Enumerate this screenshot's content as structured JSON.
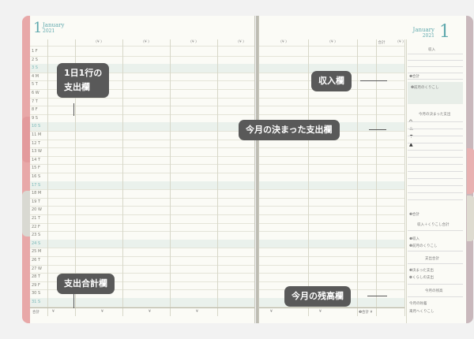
{
  "left_page": {
    "month_number": "1",
    "month_name": "January",
    "year": "2021",
    "column_headers": [
      "(¥      )",
      "(¥      )",
      "(¥      )",
      "(¥      )"
    ],
    "rows": [
      {
        "day": "1",
        "wd": "F"
      },
      {
        "day": "2",
        "wd": "S"
      },
      {
        "day": "3",
        "wd": "S"
      },
      {
        "day": "4",
        "wd": "M"
      },
      {
        "day": "5",
        "wd": "T"
      },
      {
        "day": "6",
        "wd": "W"
      },
      {
        "day": "7",
        "wd": "T"
      },
      {
        "day": "8",
        "wd": "F"
      },
      {
        "day": "9",
        "wd": "S"
      },
      {
        "day": "10",
        "wd": "S"
      },
      {
        "day": "11",
        "wd": "M"
      },
      {
        "day": "12",
        "wd": "T"
      },
      {
        "day": "13",
        "wd": "W"
      },
      {
        "day": "14",
        "wd": "T"
      },
      {
        "day": "15",
        "wd": "F"
      },
      {
        "day": "16",
        "wd": "S"
      },
      {
        "day": "17",
        "wd": "S"
      },
      {
        "day": "18",
        "wd": "M"
      },
      {
        "day": "19",
        "wd": "T"
      },
      {
        "day": "20",
        "wd": "W"
      },
      {
        "day": "21",
        "wd": "T"
      },
      {
        "day": "22",
        "wd": "F"
      },
      {
        "day": "23",
        "wd": "S"
      },
      {
        "day": "24",
        "wd": "S"
      },
      {
        "day": "25",
        "wd": "M"
      },
      {
        "day": "26",
        "wd": "T"
      },
      {
        "day": "27",
        "wd": "W"
      },
      {
        "day": "28",
        "wd": "T"
      },
      {
        "day": "29",
        "wd": "F"
      },
      {
        "day": "30",
        "wd": "S"
      },
      {
        "day": "31",
        "wd": "S"
      }
    ],
    "total_label": "合計",
    "yen": "¥"
  },
  "right_page": {
    "month_number": "1",
    "month_name": "January",
    "year": "2021",
    "column_headers": [
      "(¥      )",
      "(¥      )",
      "合計",
      "(¥      )"
    ],
    "total_label": "合計",
    "yen": "¥",
    "total_yen": "❸合計 ¥",
    "side": {
      "income_title": "収入",
      "income_total": "❶合計",
      "savings_label": "❷前月のくりこし",
      "fixed_title": "今月の決まった支出",
      "carry_total": "❸合計",
      "carry_title": "収入＋くりこし合計",
      "income_item": "❶収入",
      "savings_item": "❷前月のくりこし",
      "expense_title": "支出合計",
      "fixed_item": "❸決まった支出",
      "variable_item": "❹くらしの支出",
      "balance_title": "今月の残高",
      "this_month_savings": "今月の貯蓄",
      "next_month_carry": "来月へくりこし"
    }
  },
  "callouts": {
    "daily_row": "1日1行の\n支出欄",
    "expense_total": "支出合計欄",
    "income": "収入欄",
    "fixed_expense": "今月の決まった支出欄",
    "balance": "今月の残高欄"
  },
  "colors": {
    "accent_teal": "#5ea8ad",
    "cover_pink": "#e8a8a8",
    "callout_bg": "#595959",
    "paper": "#fbfbf6"
  }
}
